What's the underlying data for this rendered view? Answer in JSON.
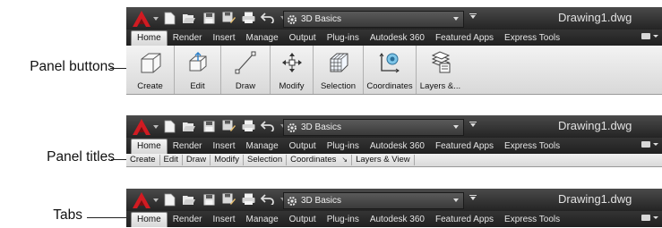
{
  "callouts": {
    "panel_buttons": "Panel buttons",
    "panel_titles": "Panel titles",
    "tabs": "Tabs"
  },
  "toolbar": {
    "workspace": "3D Basics",
    "document_title": "Drawing1.dwg",
    "icons": [
      "new-icon",
      "open-icon",
      "save-icon",
      "save-as-icon",
      "plot-icon",
      "undo-icon",
      "redo-icon"
    ]
  },
  "ribbon": {
    "tabs": [
      "Home",
      "Render",
      "Insert",
      "Manage",
      "Output",
      "Plug-ins",
      "Autodesk 360",
      "Featured Apps",
      "Express Tools"
    ],
    "active_tab": "Home",
    "panel_buttons": [
      "Create",
      "Edit",
      "Draw",
      "Modify",
      "Selection",
      "Coordinates",
      "Layers &..."
    ],
    "panel_titles": [
      "Create",
      "Edit",
      "Draw",
      "Modify",
      "Selection",
      "Coordinates",
      "Layers & View"
    ],
    "panel_title_expander": "↘"
  },
  "colors": {
    "app_button": "#c8161d",
    "title_bar_dark": "#2b2b2b",
    "panel_light": "#e6e6e6"
  }
}
